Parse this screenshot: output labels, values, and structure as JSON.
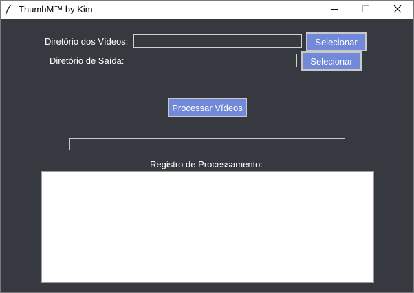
{
  "window": {
    "title": "ThumbM™  by  Kim",
    "controls": {
      "minimize": "minimize-icon",
      "maximize": "maximize-icon",
      "close": "close-icon"
    }
  },
  "form": {
    "video_dir_label": "Diretório dos Vídeos:",
    "video_dir_value": "",
    "video_dir_button": "Selecionar",
    "output_dir_label": "Diretório de Saída:",
    "output_dir_value": "",
    "output_dir_button": "Selecionar",
    "process_button": "Processar Vídeos"
  },
  "progress": {
    "value": 0
  },
  "log": {
    "label": "Registro de Processamento:",
    "content": ""
  },
  "colors": {
    "background": "#36393f",
    "button": "#7289da",
    "text": "#ffffff"
  }
}
